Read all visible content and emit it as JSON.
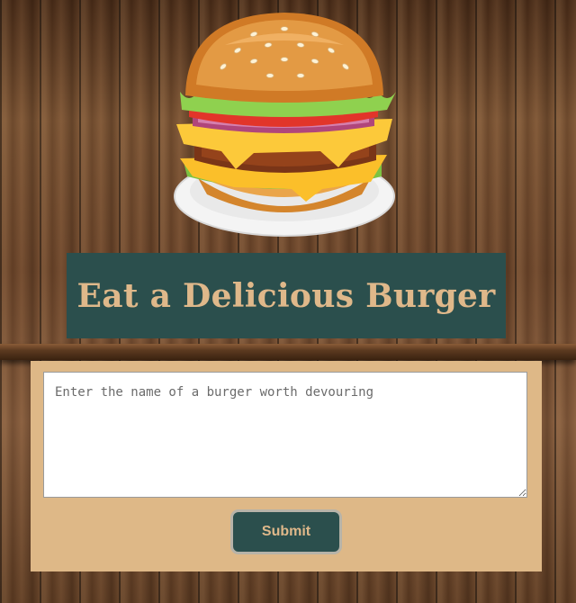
{
  "header": {
    "logo_icon": "burger-icon",
    "title": "Eat a Delicious Burger"
  },
  "form": {
    "input": {
      "value": "",
      "placeholder": "Enter the name of a burger worth devouring"
    },
    "submit_label": "Submit"
  },
  "colors": {
    "title_bg": "#2b4f4d",
    "title_text": "#dfb88a",
    "panel_bg": "#deb887",
    "wood": "#6b4429"
  }
}
